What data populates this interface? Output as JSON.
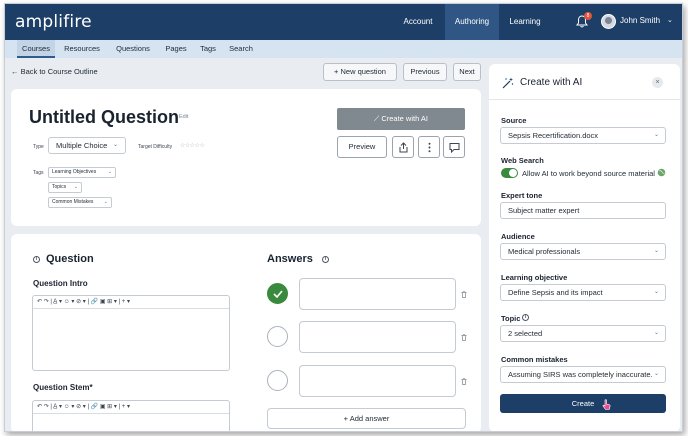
{
  "app": {
    "logo": "amplifire"
  },
  "topnav": {
    "items": [
      "Account",
      "Authoring",
      "Learning"
    ],
    "notifications_count": "8",
    "user_name": "John Smith"
  },
  "subnav": {
    "items": [
      "Courses",
      "Resources",
      "Questions",
      "Pages",
      "Tags",
      "Search"
    ]
  },
  "toolbar": {
    "back": "Back to Course Outline",
    "new_question": "+ New question",
    "previous": "Previous",
    "next": "Next"
  },
  "question": {
    "title": "Untitled Question",
    "edit": "Edit",
    "create_ai": "Create with AI",
    "preview": "Preview",
    "type_label": "Type",
    "type_value": "Multiple Choice",
    "difficulty_label": "Target Difficulty",
    "difficulty_stars": "☆☆☆☆☆",
    "tags_label": "Tags",
    "tags": [
      "Learning Objectives",
      "Topics",
      "Common Mistakes"
    ]
  },
  "editor": {
    "question_heading": "Question",
    "answers_heading": "Answers",
    "intro_label": "Question Intro",
    "stem_label": "Question Stem*",
    "toolbar_glyphs": "↶  ↷  |  A̲ ▾  ☺ ▾  ⊘ ▾  |  🔗  ▣  ⊞ ▾  |  + ▾",
    "add_answer": "+ Add answer",
    "answers_selected_index": 0
  },
  "ai_panel": {
    "title": "Create with AI",
    "source_label": "Source",
    "source_value": "Sepsis Recertification.docx",
    "web_search_label": "Web Search",
    "web_search_text": "Allow AI to work beyond source material",
    "tone_label": "Expert tone",
    "tone_value": "Subject matter expert",
    "audience_label": "Audience",
    "audience_value": "Medical professionals",
    "objective_label": "Learning objective",
    "objective_value": "Define Sepsis and its impact",
    "topic_label": "Topic",
    "topic_value": "2 selected",
    "mistakes_label": "Common mistakes",
    "mistakes_value": "Assuming SIRS was completely inaccurate...",
    "create": "Create"
  },
  "colors": {
    "nav_bg": "#1d3e66",
    "nav_active": "#2f5684",
    "subnav_bg": "#d6e3f0",
    "success": "#3a8a3e",
    "disabled_button": "#808890"
  }
}
